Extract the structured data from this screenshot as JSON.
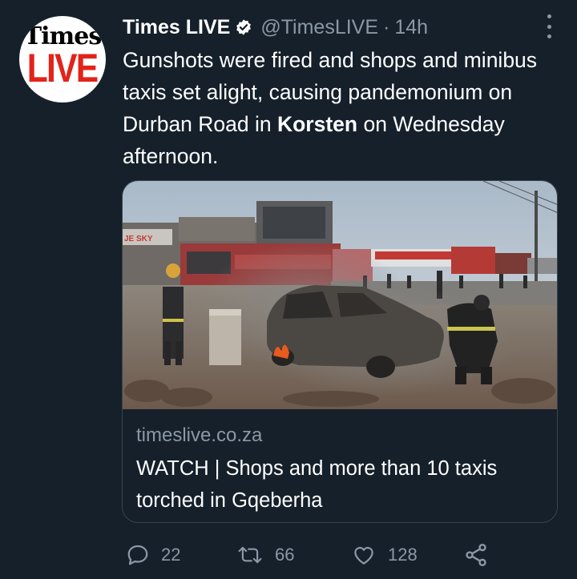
{
  "account": {
    "display_name": "Times LIVE",
    "handle": "@TimesLIVE",
    "separator": "·",
    "time": "14h",
    "avatar_text_top": "Times",
    "avatar_text_bottom": "LIVE"
  },
  "tweet": {
    "text_part1": "Gunshots were fired and shops and minibus taxis set alight, causing pandemonium on Durban Road in ",
    "text_bold": "Korsten",
    "text_part2": " on Wednesday afternoon."
  },
  "card": {
    "domain": "timeslive.co.za",
    "title": "WATCH | Shops and more than 10 taxis torched in Gqeberha",
    "sign_text": "JE SKY"
  },
  "actions": {
    "reply_count": "22",
    "retweet_count": "66",
    "like_count": "128"
  },
  "icons": {
    "verified": "verified-badge-icon",
    "more": "more-options-icon",
    "reply": "reply-icon",
    "retweet": "retweet-icon",
    "like": "like-icon",
    "share": "share-icon"
  },
  "colors": {
    "background": "#15202b",
    "text": "#ffffff",
    "secondary_text": "#8b98a5",
    "border": "#38444d",
    "brand_red": "#e2231a"
  }
}
